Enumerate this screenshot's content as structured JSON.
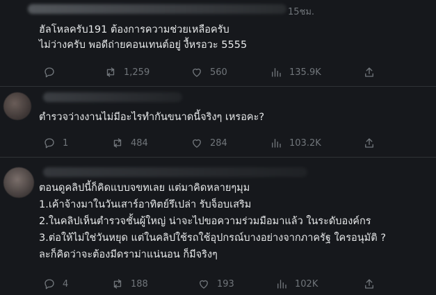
{
  "tweets": [
    {
      "time": "15ชม.",
      "lines": [
        "ฮัลโหลครับ191 ต้องการความช่วยเหลือครับ",
        "ไม่ว่างครับ พอดีถ่ายคอนเทนต์อยู่ งื้หรอวะ 5555"
      ],
      "replies": "",
      "retweets": "1,259",
      "likes": "560",
      "views": "135.9K"
    },
    {
      "time": "",
      "lines": [
        "ตำรวจว่างงานไม่มีอะไรทำกันขนาดนี้จริงๆ เหรอคะ?"
      ],
      "replies": "1",
      "retweets": "484",
      "likes": "284",
      "views": "103.2K"
    },
    {
      "time": "",
      "lines": [
        "ตอนดูคลิปนี้ก็คิดแบบจขทเลย แต่มาคิดหลายๆมุม",
        "1.เค้าจ้างมาในวันเสาร์อาทิตย์รึเปล่า รับจ็อบเสริม",
        "2.ในคลิปเห็นตำรวจชั้นผู้ใหญ่ น่าจะไปขอความร่วมมือมาแล้ว ในระดับองค์กร",
        "3.ต่อให้ไม่ใช่วันหยุด แต่ในคลิปใช้รถใช้อุปกรณ์บางอย่างจากภาครัฐ ใครอนุมัติ ?",
        "ละก็คิดว่าจะต้องมีดราม่าแน่นอน ก็มีจริงๆ"
      ],
      "replies": "4",
      "retweets": "188",
      "likes": "193",
      "views": "102K"
    }
  ],
  "icons": [
    "reply-icon",
    "retweet-icon",
    "like-icon",
    "views-icon",
    "share-icon"
  ]
}
